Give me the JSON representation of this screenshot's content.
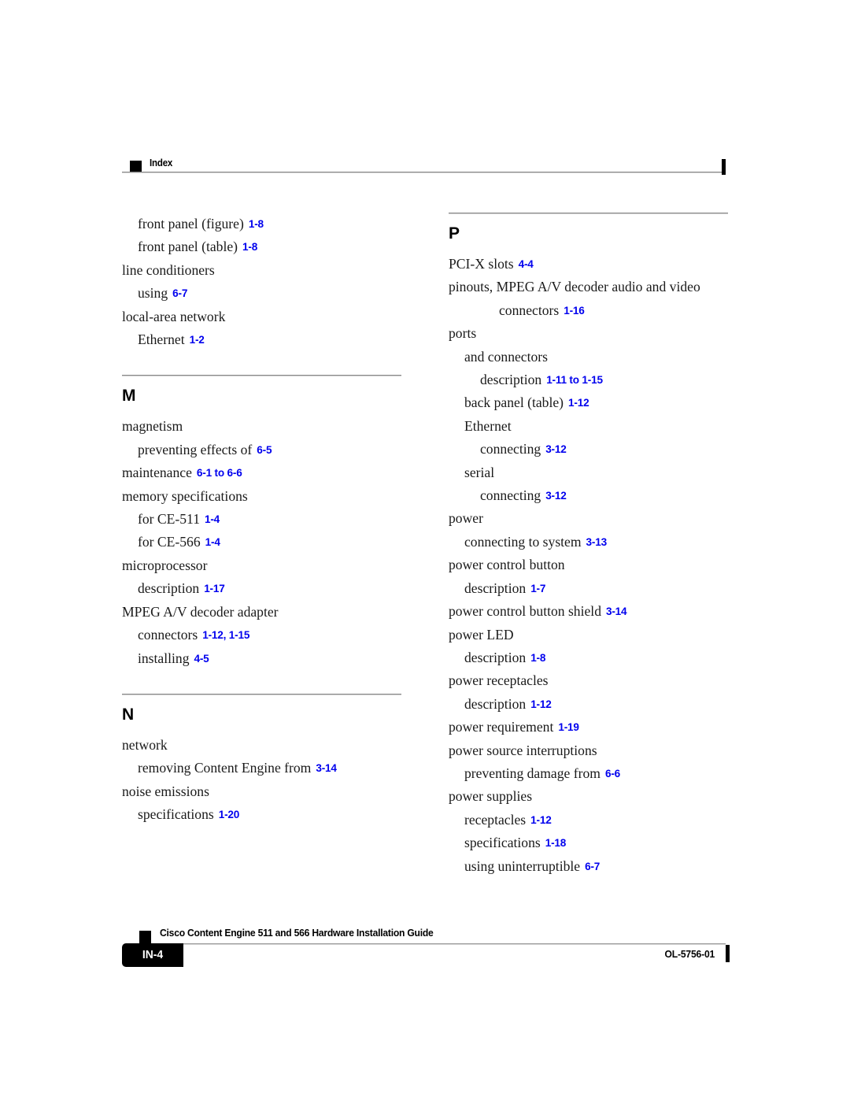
{
  "header": {
    "marker_icon": "black-square-marker",
    "title": "Index",
    "edge_tick_icon": "page-edge-tick"
  },
  "footer": {
    "marker_icon": "black-square-marker",
    "page_number": "IN-4",
    "book_title": "Cisco Content Engine 511 and 566 Hardware Installation Guide",
    "doc_id": "OL-5756-01",
    "edge_tick_icon": "page-edge-tick"
  },
  "colors": {
    "page_reference": "#0000ee",
    "text": "#1a1a1a",
    "rule": "#8a8a8a",
    "marker": "#000000"
  },
  "columns": [
    {
      "name": "left-column",
      "sections": [
        {
          "letter": "",
          "has_rule": false,
          "entries": [
            {
              "level": 1,
              "text": "front panel (figure)",
              "ref": "1-8"
            },
            {
              "level": 1,
              "text": "front panel (table)",
              "ref": "1-8"
            },
            {
              "level": 0,
              "text": "line conditioners",
              "ref": ""
            },
            {
              "level": 1,
              "text": "using",
              "ref": "6-7"
            },
            {
              "level": 0,
              "text": "local-area network",
              "ref": ""
            },
            {
              "level": 1,
              "text": "Ethernet",
              "ref": "1-2"
            }
          ]
        },
        {
          "letter": "M",
          "has_rule": true,
          "entries": [
            {
              "level": 0,
              "text": "magnetism",
              "ref": ""
            },
            {
              "level": 1,
              "text": "preventing effects of",
              "ref": "6-5"
            },
            {
              "level": 0,
              "text": "maintenance",
              "ref": "6-1 to 6-6"
            },
            {
              "level": 0,
              "text": "memory specifications",
              "ref": ""
            },
            {
              "level": 1,
              "text": "for CE-511",
              "ref": "1-4"
            },
            {
              "level": 1,
              "text": "for CE-566",
              "ref": "1-4"
            },
            {
              "level": 0,
              "text": "microprocessor",
              "ref": ""
            },
            {
              "level": 1,
              "text": "description",
              "ref": "1-17"
            },
            {
              "level": 0,
              "text": "MPEG A/V decoder adapter",
              "ref": ""
            },
            {
              "level": 1,
              "text": "connectors",
              "ref": "1-12, 1-15"
            },
            {
              "level": 1,
              "text": "installing",
              "ref": "4-5"
            }
          ]
        },
        {
          "letter": "N",
          "has_rule": true,
          "entries": [
            {
              "level": 0,
              "text": "network",
              "ref": ""
            },
            {
              "level": 1,
              "text": "removing Content Engine from",
              "ref": "3-14"
            },
            {
              "level": 0,
              "text": "noise emissions",
              "ref": ""
            },
            {
              "level": 1,
              "text": "specifications",
              "ref": "1-20"
            }
          ]
        }
      ]
    },
    {
      "name": "right-column",
      "sections": [
        {
          "letter": "P",
          "has_rule": true,
          "entries": [
            {
              "level": 0,
              "text": "PCI-X slots",
              "ref": "4-4"
            },
            {
              "level": 0,
              "text": "pinouts, MPEG A/V decoder audio and video",
              "ref": ""
            },
            {
              "level": 3,
              "text": "connectors",
              "ref": "1-16"
            },
            {
              "level": 0,
              "text": "ports",
              "ref": ""
            },
            {
              "level": 1,
              "text": "and connectors",
              "ref": ""
            },
            {
              "level": 2,
              "text": "description",
              "ref": "1-11 to 1-15"
            },
            {
              "level": 1,
              "text": "back panel (table)",
              "ref": "1-12"
            },
            {
              "level": 1,
              "text": "Ethernet",
              "ref": ""
            },
            {
              "level": 2,
              "text": "connecting",
              "ref": "3-12"
            },
            {
              "level": 1,
              "text": "serial",
              "ref": ""
            },
            {
              "level": 2,
              "text": "connecting",
              "ref": "3-12"
            },
            {
              "level": 0,
              "text": "power",
              "ref": ""
            },
            {
              "level": 1,
              "text": "connecting to system",
              "ref": "3-13"
            },
            {
              "level": 0,
              "text": "power control button",
              "ref": ""
            },
            {
              "level": 1,
              "text": "description",
              "ref": "1-7"
            },
            {
              "level": 0,
              "text": "power control button shield",
              "ref": "3-14"
            },
            {
              "level": 0,
              "text": "power LED",
              "ref": ""
            },
            {
              "level": 1,
              "text": "description",
              "ref": "1-8"
            },
            {
              "level": 0,
              "text": "power receptacles",
              "ref": ""
            },
            {
              "level": 1,
              "text": "description",
              "ref": "1-12"
            },
            {
              "level": 0,
              "text": "power requirement",
              "ref": "1-19"
            },
            {
              "level": 0,
              "text": "power source interruptions",
              "ref": ""
            },
            {
              "level": 1,
              "text": "preventing damage from",
              "ref": "6-6"
            },
            {
              "level": 0,
              "text": "power supplies",
              "ref": ""
            },
            {
              "level": 1,
              "text": "receptacles",
              "ref": "1-12"
            },
            {
              "level": 1,
              "text": "specifications",
              "ref": "1-18"
            },
            {
              "level": 1,
              "text": "using uninterruptible",
              "ref": "6-7"
            }
          ]
        }
      ]
    }
  ]
}
